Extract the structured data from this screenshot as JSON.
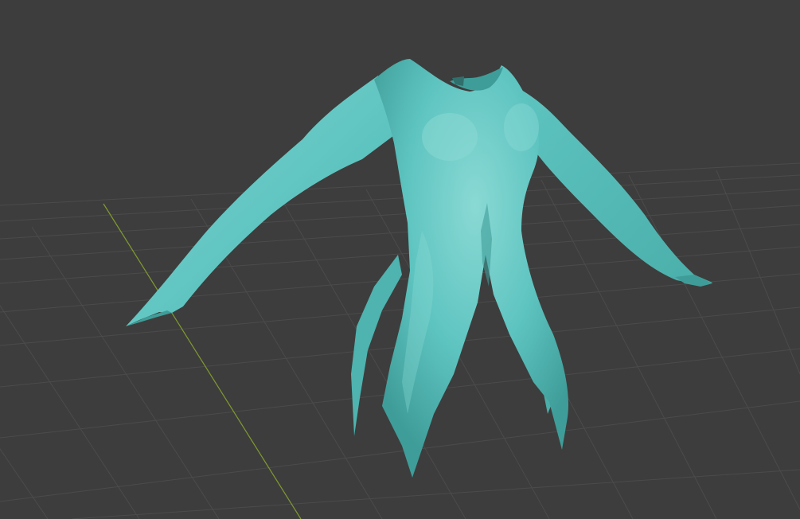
{
  "viewport": {
    "view": "perspective",
    "background_color": "#3d3d3d",
    "grid_line_color": "#4b4b4b",
    "y_axis_color": "#7f9a2e",
    "grid_visible": true
  },
  "mesh": {
    "object": "garment",
    "shading": "solid",
    "base_color": "#5ec4c0",
    "light_color": "#8ad9d4",
    "shadow_color": "#3f9d99",
    "rim_color": "#2f7c79"
  }
}
